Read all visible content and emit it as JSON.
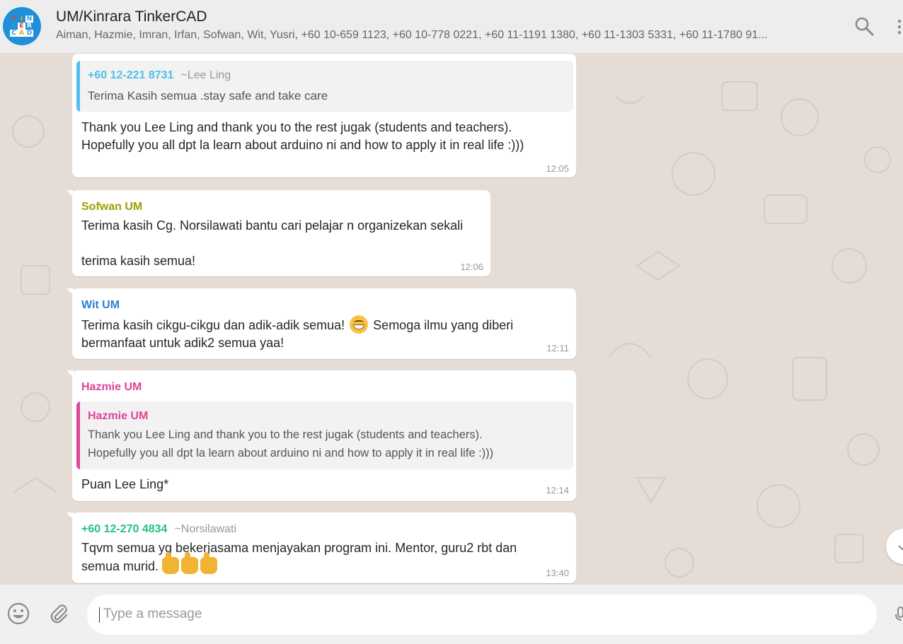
{
  "header": {
    "avatar_letters": [
      "T",
      "I",
      "N",
      "K",
      "E",
      "R",
      "C",
      "A",
      "D"
    ],
    "title": "UM/Kinrara TinkerCAD",
    "participants": "Aiman, Hazmie, Imran, Irfan, Sofwan, Wit, Yusri, +60 10-659 1123, +60 10-778 0221, +60 11-1191 1380, +60 11-1303 5331, +60 11-1780 91...",
    "icons": [
      "search-icon",
      "menu-icon"
    ]
  },
  "messages": [
    {
      "quote": {
        "sender": "+60 12-221 8731",
        "sender_note": "~Lee Ling",
        "text": "Terima Kasih semua .stay safe and take care",
        "color": "#53bdeb"
      },
      "text": "Thank you Lee Ling and thank you to the rest jugak (students and teachers).\nHopefully you all dpt la learn about arduino ni and how to apply it in real life :)))",
      "time": "12:05"
    },
    {
      "sender": "Sofwan UM",
      "sender_color": "#9aa100",
      "text": "Terima kasih Cg. Norsilawati bantu cari pelajar n organizekan sekali\n\nterima kasih semua!",
      "time": "12:06"
    },
    {
      "sender": "Wit UM",
      "sender_color": "#2a7fd4",
      "text_before_emoji": "Terima kasih cikgu-cikgu dan adik-adik semua! ",
      "text_after_emoji": " Semoga ilmu yang diberi",
      "text_line2": "bermanfaat untuk adik2 semua yaa!",
      "emoji": "grinning-emoji",
      "time": "12:11"
    },
    {
      "sender": "Hazmie UM",
      "sender_color": "#e0439a",
      "quote": {
        "sender": "Hazmie UM",
        "text": "Thank you Lee Ling and thank you to the rest jugak (students and teachers).\nHopefully you all dpt la learn about arduino ni and how to apply it in real life :)))",
        "color": "#e0439a"
      },
      "text": "Puan Lee Ling*",
      "time": "12:14"
    },
    {
      "sender": "+60 12-270 4834",
      "sender_note": "~Norsilawati",
      "sender_color": "#25c07d",
      "text_line1": "Tqvm semua yg bekerjasama menjayakan program ini. Mentor, guru2 rbt dan",
      "text_line2": "semua murid. ",
      "emoji": "thumbs-up-emoji",
      "time": "13:40"
    }
  ],
  "composer": {
    "placeholder": "Type a message",
    "icons": [
      "emoji-icon",
      "attach-icon",
      "mic-icon"
    ]
  }
}
